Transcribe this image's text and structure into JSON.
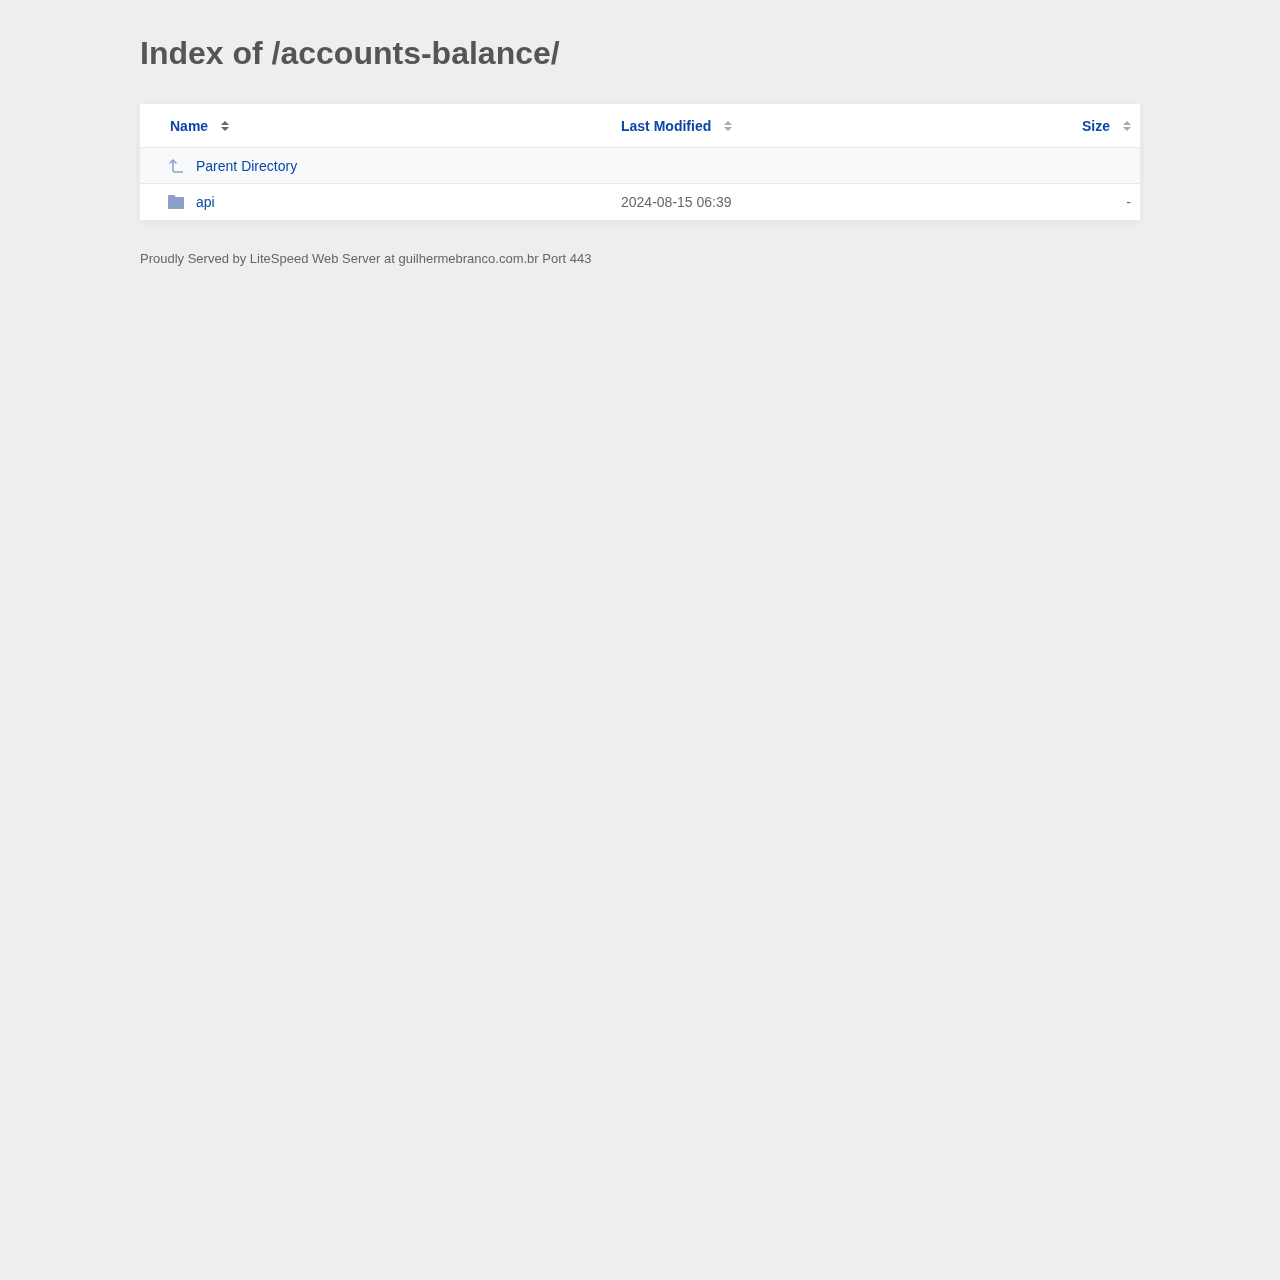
{
  "title": "Index of /accounts-balance/",
  "table": {
    "columns": [
      {
        "label": "Name",
        "selected": true
      },
      {
        "label": "Last Modified",
        "selected": false
      },
      {
        "label": "Size",
        "selected": false
      }
    ],
    "rows": [
      {
        "kind": "parent",
        "name": "Parent Directory"
      },
      {
        "kind": "folder",
        "name": "api",
        "modified": "2024-08-15 06:39",
        "size": "-"
      }
    ]
  },
  "footer": "Proudly Served by LiteSpeed Web Server at guilhermebranco.com.br Port 443"
}
